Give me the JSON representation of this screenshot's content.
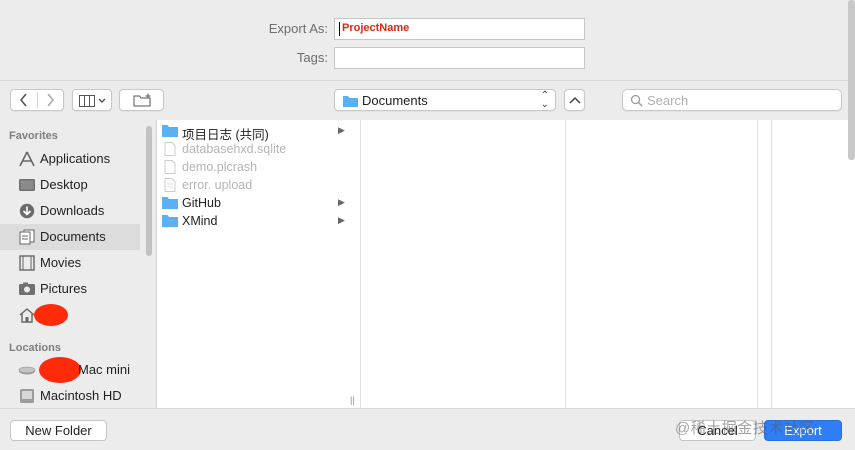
{
  "dialog": {
    "export_as_label": "Export As:",
    "export_as_value": "ProjectName",
    "tags_label": "Tags:",
    "tags_value": ""
  },
  "toolbar": {
    "back_icon": "chevron-left-icon",
    "forward_icon": "chevron-right-icon",
    "view_mode_icon": "column-view-icon",
    "new_folder_icon": "new-folder-icon",
    "location": "Documents",
    "expand_icon": "chevron-up-icon",
    "search_placeholder": "Search"
  },
  "sidebar": {
    "favorites_header": "Favorites",
    "favorites": [
      {
        "label": "Applications",
        "icon": "applications-icon"
      },
      {
        "label": "Desktop",
        "icon": "desktop-icon"
      },
      {
        "label": "Downloads",
        "icon": "downloads-icon"
      },
      {
        "label": "Documents",
        "icon": "documents-icon",
        "selected": true
      },
      {
        "label": "Movies",
        "icon": "movies-icon"
      },
      {
        "label": "Pictures",
        "icon": "pictures-icon"
      },
      {
        "label": "",
        "icon": "home-icon",
        "redacted": true
      }
    ],
    "locations_header": "Locations",
    "locations": [
      {
        "label": "Mac mini",
        "icon": "computer-icon",
        "redacted_prefix": true
      },
      {
        "label": "Macintosh HD",
        "icon": "disk-icon"
      }
    ]
  },
  "browser": {
    "column1": [
      {
        "name": "项目日志 (共同)",
        "type": "folder",
        "has_children": true,
        "enabled": true
      },
      {
        "name": "databasehxd.sqlite",
        "type": "file",
        "has_children": false,
        "enabled": false
      },
      {
        "name": "demo.plcrash",
        "type": "file",
        "has_children": false,
        "enabled": false
      },
      {
        "name": "error. upload",
        "type": "file",
        "has_children": false,
        "enabled": false
      },
      {
        "name": "GitHub",
        "type": "folder",
        "has_children": true,
        "enabled": true
      },
      {
        "name": "XMind",
        "type": "folder",
        "has_children": true,
        "enabled": true
      }
    ]
  },
  "footer": {
    "new_folder": "New Folder",
    "cancel": "Cancel",
    "export": "Export",
    "watermark": "@稀土掘金技术社区"
  },
  "colors": {
    "accent": "#2f7ef5",
    "filename_text": "#e0260d",
    "folder": "#5ab0f0",
    "redaction": "#ff2a0a"
  }
}
